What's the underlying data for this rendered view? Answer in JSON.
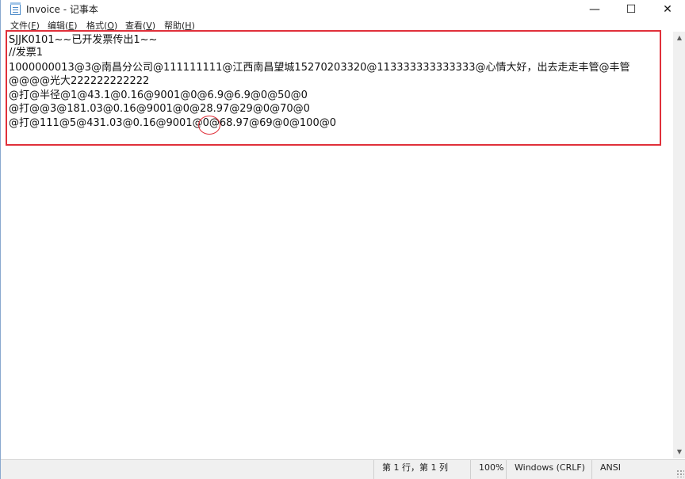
{
  "window": {
    "title": "Invoice - 记事本",
    "controls": {
      "minimize": "—",
      "maximize": "☐",
      "close": "✕"
    }
  },
  "menu": {
    "items": [
      {
        "label": "文件(",
        "accel": "F",
        "tail": ")"
      },
      {
        "label": "编辑(",
        "accel": "E",
        "tail": ")"
      },
      {
        "label": "格式(",
        "accel": "O",
        "tail": ")"
      },
      {
        "label": "查看(",
        "accel": "V",
        "tail": ")"
      },
      {
        "label": "帮助(",
        "accel": "H",
        "tail": ")"
      }
    ]
  },
  "editor": {
    "lines": [
      "SJJK0101~~已开发票传出1~~",
      "//发票1",
      "1000000013@3@南昌分公司@111111111@江西南昌望城15270203320@113333333333333@心情大好，出去走走丰管@丰管",
      "@@@@光大222222222222",
      "@打@半径@1@43.1@0.16@9001@0@6.9@6.9@0@50@0",
      "@打@@3@181.03@0.16@9001@0@28.97@29@0@70@0",
      "@打@111@5@431.03@0.16@9001@0@68.97@69@0@100@0"
    ]
  },
  "annotation": {
    "box_color": "#e0303a"
  },
  "status": {
    "position": "第 1 行，第 1 列",
    "zoom": "100%",
    "line_ending": "Windows (CRLF)",
    "encoding": "ANSI"
  }
}
